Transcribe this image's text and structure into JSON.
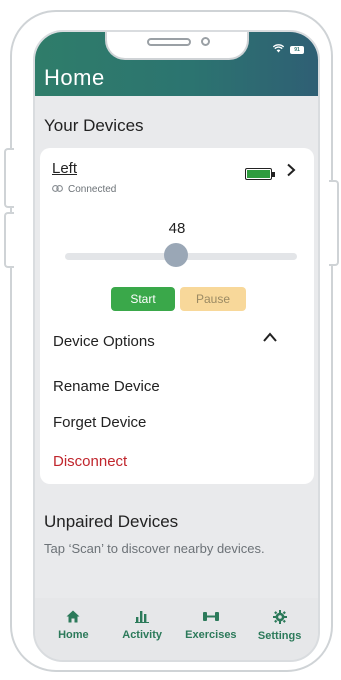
{
  "status_bar": {
    "battery_text": "91",
    "wifi_icon": "wifi-icon"
  },
  "header": {
    "title": "Home"
  },
  "devices_section": {
    "title": "Your Devices"
  },
  "device": {
    "name": "Left",
    "connection_status": "Connected",
    "battery_level": 1.0,
    "slider_value": "48",
    "slider_fraction": 0.48,
    "start_label": "Start",
    "pause_label": "Pause",
    "options_title": "Device Options",
    "options": {
      "rename": "Rename Device",
      "forget": "Forget Device",
      "disconnect": "Disconnect"
    }
  },
  "unpaired_section": {
    "title": "Unpaired Devices",
    "hint": "Tap ‘Scan’ to discover nearby devices."
  },
  "tabs": [
    {
      "label": "Home",
      "icon": "home-icon"
    },
    {
      "label": "Activity",
      "icon": "bar-chart-icon"
    },
    {
      "label": "Exercises",
      "icon": "dumbbell-icon"
    },
    {
      "label": "Settings",
      "icon": "gear-icon"
    }
  ],
  "colors": {
    "accent": "#2c7470",
    "start": "#3aa84a",
    "pause": "#f8d89a",
    "danger": "#c0262d",
    "battery": "#2e9c3e"
  }
}
